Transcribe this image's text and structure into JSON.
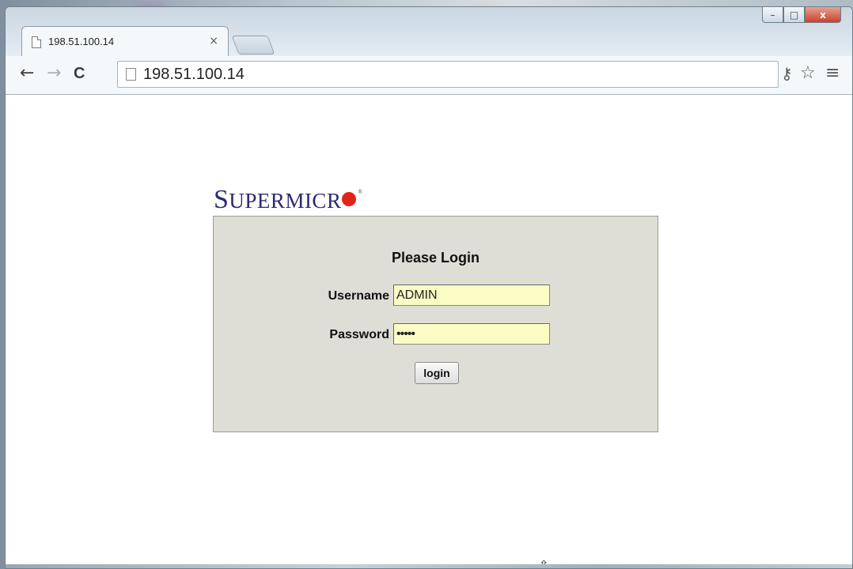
{
  "browser": {
    "tab": {
      "title": "198.51.100.14",
      "close": "×"
    },
    "address": {
      "url": "198.51.100.14"
    },
    "nav": {
      "back": "←",
      "forward": "→",
      "reload": "C"
    },
    "toolbar_right": {
      "key": "⚷",
      "star": "☆",
      "menu": "≡"
    },
    "caption": {
      "minimize": "–",
      "maximize": "□",
      "close": "x"
    }
  },
  "page": {
    "logo": {
      "text_big": "S",
      "text_small": "UPERMICR",
      "reg": "®"
    },
    "login": {
      "title": "Please Login",
      "username_label": "Username",
      "username_value": "ADMIN",
      "password_label": "Password",
      "password_value": "•••••",
      "button_label": "login"
    }
  },
  "colors": {
    "logo_navy": "#2a2a72",
    "logo_dot_red": "#e2231a",
    "login_bg": "#deded6",
    "field_bg": "#fbfbc4"
  },
  "cursor": {
    "icon": "move-cursor-icon"
  }
}
